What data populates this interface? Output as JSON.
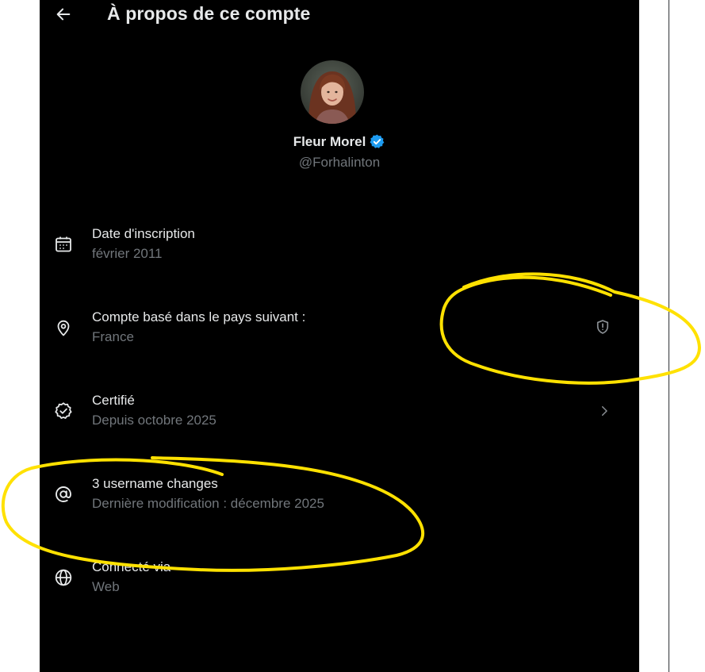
{
  "header": {
    "title": "À propos de ce compte",
    "back_icon": "arrow-left-icon"
  },
  "profile": {
    "name": "Fleur Morel",
    "handle": "@Forhalinton",
    "verified_icon": "verified-badge-icon",
    "verified_color": "#1d9bf0"
  },
  "items": [
    {
      "icon": "calendar-icon",
      "title": "Date d'inscription",
      "subtitle": "février 2011"
    },
    {
      "icon": "location-pin-icon",
      "title": "Compte basé dans le pays suivant :",
      "subtitle": "France",
      "trailing_icon": "shield-alert-icon"
    },
    {
      "icon": "verified-check-icon",
      "title": "Certifié",
      "subtitle": "Depuis octobre 2025",
      "trailing_icon": "chevron-right-icon"
    },
    {
      "icon": "at-sign-icon",
      "title": "3 username changes",
      "subtitle": "Dernière modification : décembre 2025"
    },
    {
      "icon": "globe-icon",
      "title": "Connecté via",
      "subtitle": "Web"
    }
  ],
  "colors": {
    "background": "#000000",
    "text_primary": "#e7e9ea",
    "text_secondary": "#71767b",
    "annotation": "#ffe100"
  }
}
